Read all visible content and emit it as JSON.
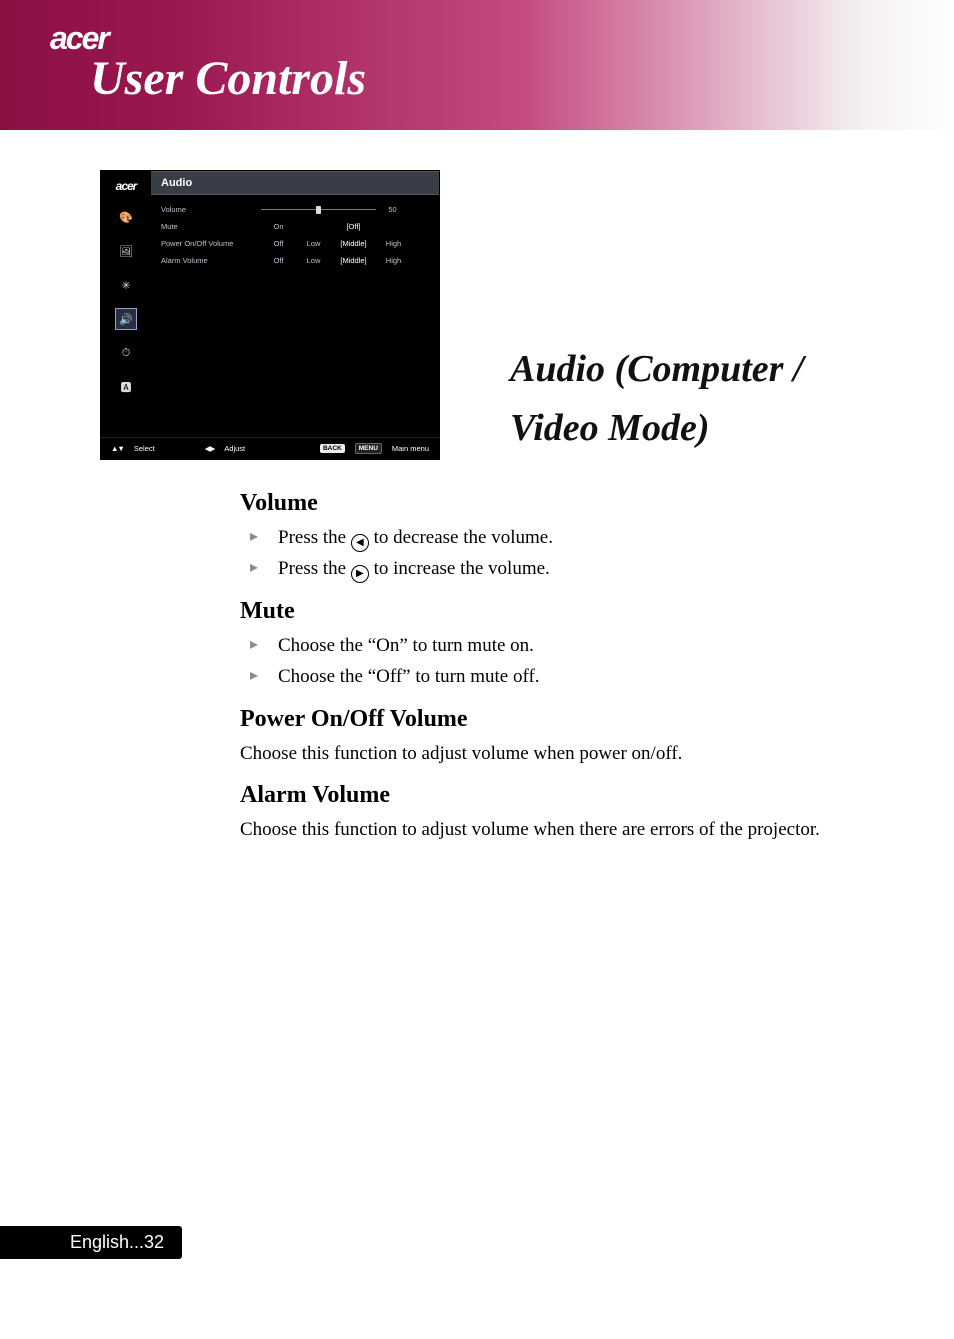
{
  "brand": "acer",
  "banner_title": "User Controls",
  "section_title": "Audio (Computer / Video Mode)",
  "osd": {
    "brand": "acer",
    "header": "Audio",
    "rows": {
      "volume_label": "Volume",
      "volume_value": "50",
      "mute_label": "Mute",
      "mute_opts": {
        "on": "On",
        "off_sel": "[Off]"
      },
      "power_label": "Power On/Off Volume",
      "alarm_label": "Alarm Volume",
      "multi_opts": {
        "off": "Off",
        "low": "Low",
        "mid_sel": "[Middle]",
        "high": "High"
      }
    },
    "footer": {
      "select": "Select",
      "adjust": "Adjust",
      "back": "BACK",
      "menu": "MENU",
      "main_menu": "Main menu"
    }
  },
  "sections": {
    "volume": {
      "heading": "Volume",
      "b1a": "Press the ",
      "b1b": " to decrease the volume.",
      "b2a": "Press the ",
      "b2b": " to increase the volume."
    },
    "mute": {
      "heading": "Mute",
      "b1": "Choose the “On” to turn mute on.",
      "b2": "Choose the “Off” to turn mute off."
    },
    "power": {
      "heading": "Power On/Off Volume",
      "p": "Choose this function to adjust volume when power on/off."
    },
    "alarm": {
      "heading": "Alarm Volume",
      "p": "Choose this function to adjust volume when there are errors of the projector."
    }
  },
  "footer_page": "English...32"
}
